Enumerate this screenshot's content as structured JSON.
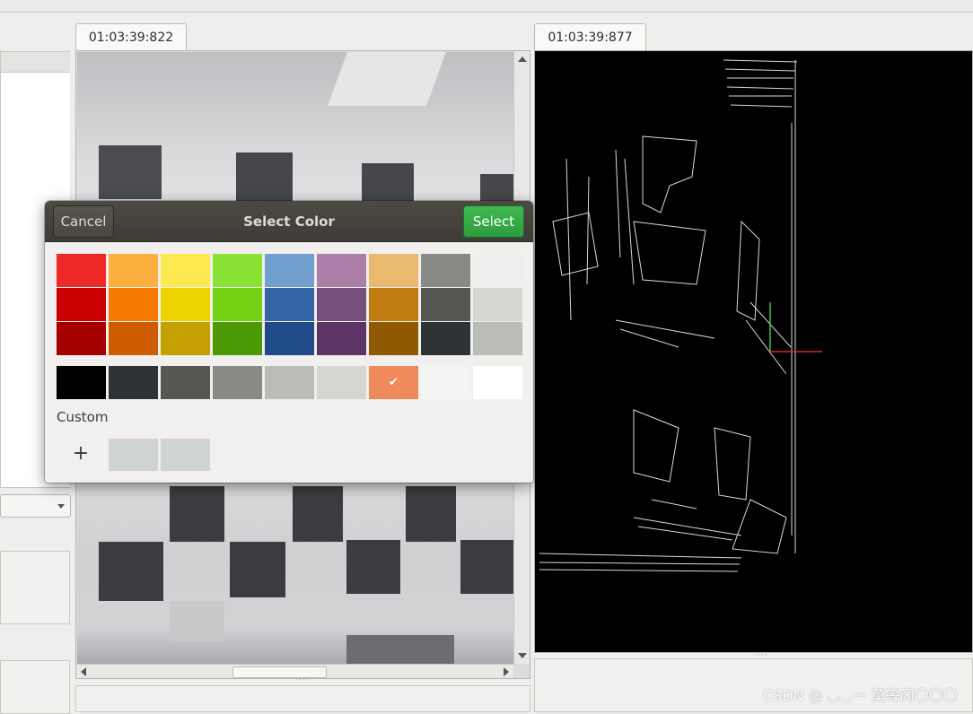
{
  "tabs": {
    "left_timestamp": "01:03:39:822",
    "right_timestamp": "01:03:39:877"
  },
  "dialog": {
    "title": "Select Color",
    "cancel_label": "Cancel",
    "select_label": "Select",
    "custom_label": "Custom",
    "add_custom_symbol": "+",
    "selected_check": "✔",
    "palette_columns": [
      [
        "#ef2929",
        "#cc0000",
        "#a40000"
      ],
      [
        "#fcaf3e",
        "#f57900",
        "#ce5c00"
      ],
      [
        "#fce94f",
        "#edd400",
        "#c4a000"
      ],
      [
        "#8ae234",
        "#73d216",
        "#4e9a06"
      ],
      [
        "#729fcf",
        "#3465a4",
        "#204a87"
      ],
      [
        "#ad7fa8",
        "#75507b",
        "#5c3566"
      ],
      [
        "#e9b96e",
        "#c17d11",
        "#8f5902"
      ],
      [
        "#888a85",
        "#555753",
        "#2e3436"
      ],
      [
        "#eeeeec",
        "#d3d7cf",
        "#babdb6"
      ]
    ],
    "grays_row": [
      "#000000",
      "#2e3436",
      "#555753",
      "#888a85",
      "#babdb6",
      "#d3d7cf",
      "#ef8a5a",
      "#f3f3f3",
      "#ffffff"
    ],
    "selected_color": "#ef8a5a",
    "custom_colors": [
      "#d0d3d3",
      "#d0d3d3"
    ]
  },
  "watermark": "CSDN @ ◡◡一 莫等闲〇〇〇"
}
